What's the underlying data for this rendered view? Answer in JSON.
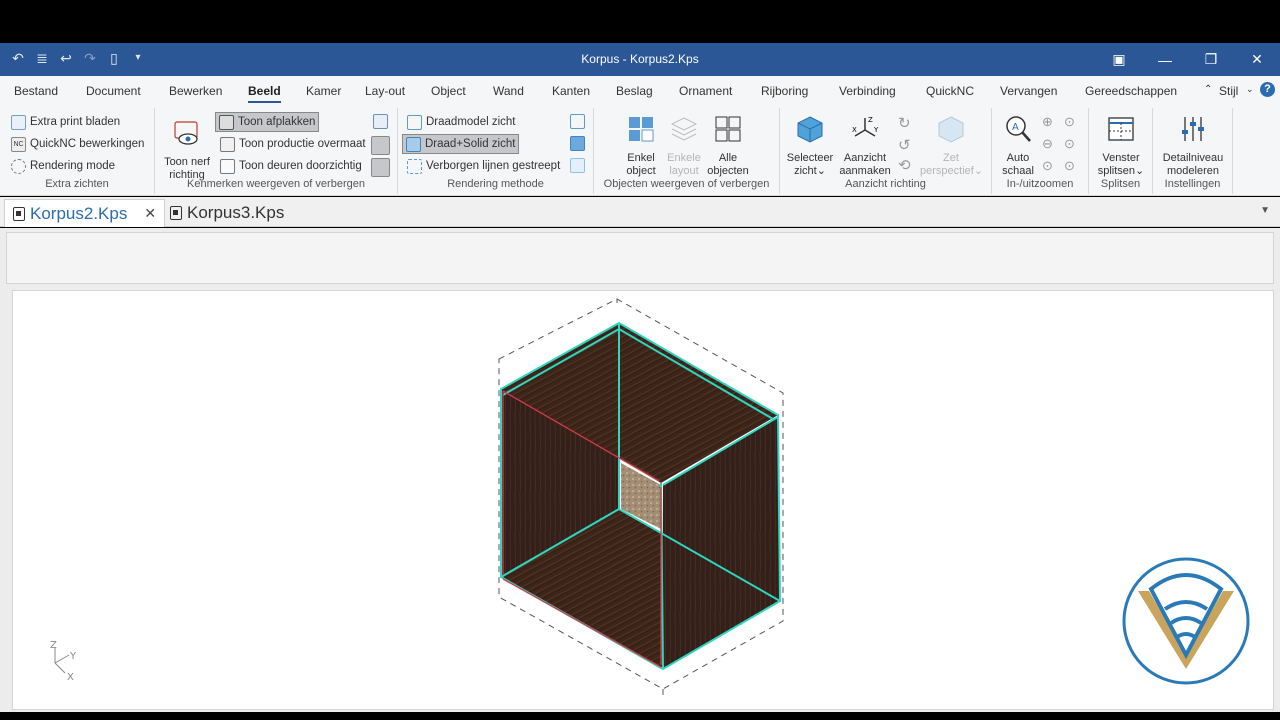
{
  "window": {
    "title": "Korpus - Korpus2.Kps"
  },
  "menu": {
    "tabs": [
      "Bestand",
      "Document",
      "Bewerken",
      "Beeld",
      "Kamer",
      "Lay-out",
      "Object",
      "Wand",
      "Kanten",
      "Beslag",
      "Ornament",
      "Rijboring",
      "Verbinding",
      "QuickNC",
      "Vervangen",
      "Gereedschappen"
    ],
    "active": "Beeld",
    "style_label": "Stijl"
  },
  "ribbon": {
    "extra_zichten": {
      "label": "Extra zichten",
      "items": [
        "Extra print bladen",
        "QuickNC bewerkingen",
        "Rendering mode"
      ]
    },
    "kenmerken": {
      "label": "Kenmerken weergeven of verbergen",
      "nerf_line1": "Toon nerf",
      "nerf_line2": "richting",
      "items": [
        "Toon afplakken",
        "Toon productie overmaat",
        "Toon deuren doorzichtig"
      ]
    },
    "rendering": {
      "label": "Rendering methode",
      "items": [
        "Draadmodel zicht",
        "Draad+Solid zicht",
        "Verborgen lijnen gestreept"
      ]
    },
    "objecten": {
      "label": "Objecten weergeven of verbergen",
      "enkel_1": "Enkel",
      "enkel_2": "object",
      "layout_1": "Enkele",
      "layout_2": "layout",
      "alle_1": "Alle",
      "alle_2": "objecten"
    },
    "aanzicht": {
      "label": "Aanzicht richting",
      "selecteer_1": "Selecteer",
      "selecteer_2": "zicht",
      "aanmaken_1": "Aanzicht",
      "aanmaken_2": "aanmaken",
      "perspectief_1": "Zet",
      "perspectief_2": "perspectief"
    },
    "zoom": {
      "label": "In-/uitzoomen",
      "auto_1": "Auto",
      "auto_2": "schaal"
    },
    "splitsen": {
      "label": "Splitsen",
      "venster_1": "Venster",
      "venster_2": "splitsen"
    },
    "instellingen": {
      "label": "Instellingen",
      "detail_1": "Detailniveau",
      "detail_2": "modeleren"
    }
  },
  "documents": {
    "tabs": [
      "Korpus2.Kps",
      "Korpus3.Kps"
    ],
    "active": "Korpus2.Kps"
  },
  "colors": {
    "titlebar": "#2b5797",
    "wireframe": "#2fd6c0",
    "wood": "#3b2418",
    "edge_red": "#d23a4a"
  },
  "axis": {
    "z": "Z",
    "y": "Y",
    "x": "X"
  }
}
